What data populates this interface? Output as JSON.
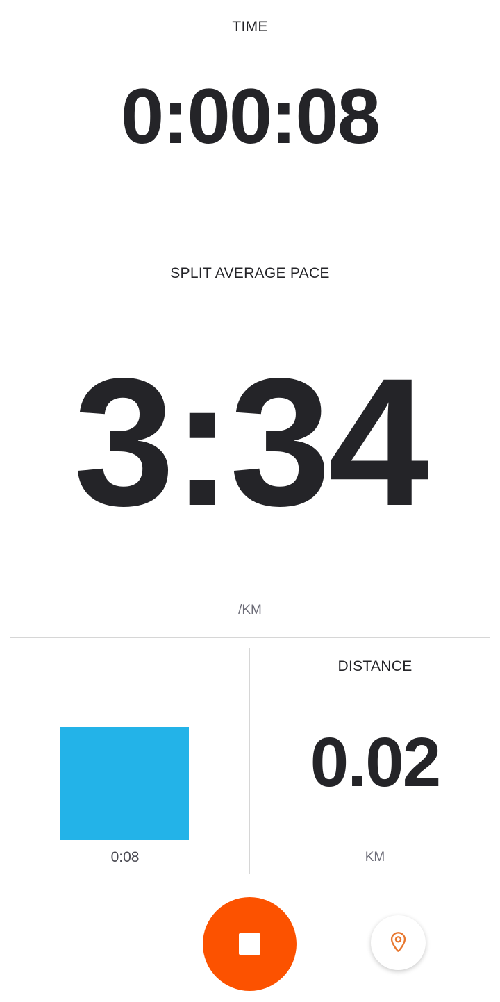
{
  "time": {
    "label": "TIME",
    "value": "0:00:08"
  },
  "pace": {
    "label": "SPLIT AVERAGE PACE",
    "value": "3:34",
    "unit": "/KM"
  },
  "split": {
    "time": "0:08",
    "bar_fill_fraction": 0.62,
    "bar_color": "#23b3e8"
  },
  "distance": {
    "label": "DISTANCE",
    "value": "0.02",
    "unit": "KM"
  },
  "controls": {
    "stop_icon": "stop-icon",
    "location_icon": "location-pin-icon",
    "stop_color": "#fc5200",
    "location_color": "#e8772f"
  }
}
